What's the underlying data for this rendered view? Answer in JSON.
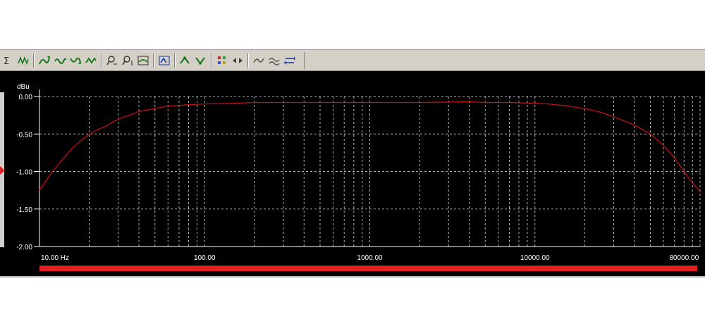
{
  "toolbar": {
    "buttons": [
      {
        "icon": "sigma-icon"
      },
      {
        "icon": "waveform-icon"
      },
      {
        "icon": "curve-up-icon"
      },
      {
        "icon": "curve-wave-icon"
      },
      {
        "icon": "curve-down-icon"
      },
      {
        "icon": "curve-pulse-icon"
      },
      {
        "icon": "zoom-x-icon"
      },
      {
        "icon": "zoom-y-icon"
      },
      {
        "icon": "fit-curve-icon"
      },
      {
        "icon": "cursor-curve-icon"
      },
      {
        "icon": "peak-up-icon"
      },
      {
        "icon": "peak-down-icon"
      },
      {
        "icon": "dots-icon"
      },
      {
        "icon": "arrows-icon"
      },
      {
        "icon": "filter-icon"
      },
      {
        "icon": "compare-icon"
      },
      {
        "icon": "swap-icon"
      }
    ]
  },
  "chart_data": {
    "type": "line",
    "ylabel": "dBu",
    "x_scale": "log",
    "xlim": [
      10,
      100000
    ],
    "ylim": [
      -2.0,
      0.0
    ],
    "yticks": [
      0.0,
      -0.5,
      -1.0,
      -1.5,
      -2.0
    ],
    "ytick_labels": [
      "0.00",
      "-0.50",
      "-1.00",
      "-1.50",
      "-2.00"
    ],
    "xtick_labels": [
      {
        "value": 10,
        "label": "10.00 Hz"
      },
      {
        "value": 100,
        "label": "100.00"
      },
      {
        "value": 1000,
        "label": "1000.00"
      },
      {
        "value": 10000,
        "label": "10000.00"
      },
      {
        "value": 80000,
        "label": "80000.00"
      }
    ],
    "grid": true,
    "series": [
      {
        "color": "#c01010",
        "x": [
          10,
          12,
          14,
          16,
          18,
          20,
          22,
          25,
          30,
          35,
          40,
          50,
          60,
          80,
          100,
          150,
          200,
          300,
          500,
          1000,
          2000,
          4000,
          5000,
          7000,
          10000,
          12000,
          15000,
          20000,
          25000,
          30000,
          40000,
          50000,
          60000,
          70000,
          80000,
          90000,
          100000
        ],
        "y": [
          -1.25,
          -1.0,
          -0.82,
          -0.68,
          -0.58,
          -0.51,
          -0.45,
          -0.4,
          -0.3,
          -0.25,
          -0.2,
          -0.16,
          -0.13,
          -0.11,
          -0.1,
          -0.09,
          -0.08,
          -0.08,
          -0.08,
          -0.08,
          -0.08,
          -0.07,
          -0.08,
          -0.08,
          -0.09,
          -0.1,
          -0.12,
          -0.16,
          -0.21,
          -0.27,
          -0.38,
          -0.5,
          -0.65,
          -0.82,
          -1.0,
          -1.15,
          -1.27
        ]
      }
    ]
  },
  "colors": {
    "background": "#000000",
    "grid": "#cfcfcf",
    "curve": "#c01010",
    "range_bar": "#e02020"
  }
}
